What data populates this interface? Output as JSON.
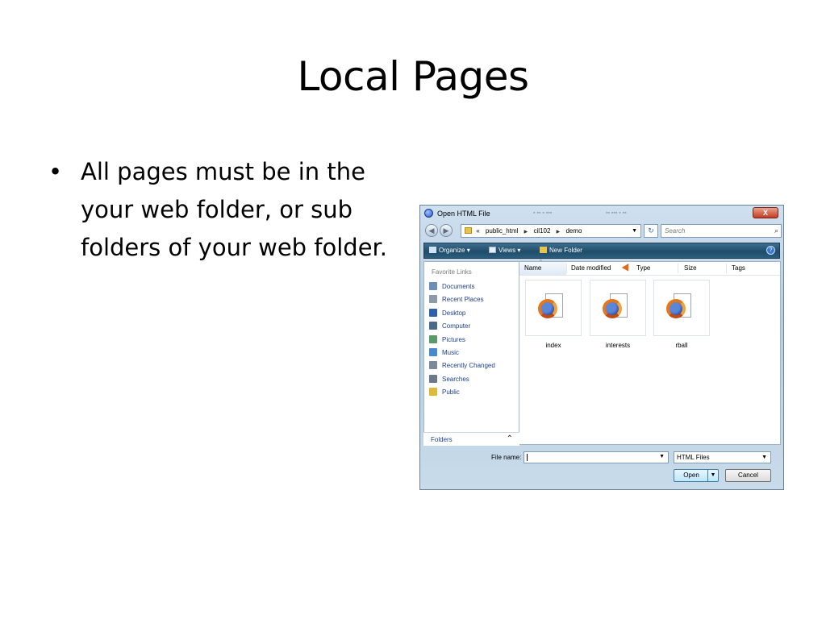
{
  "slide": {
    "title": "Local Pages",
    "bullets": [
      "All pages must be in the your web folder, or sub folders of your web folder."
    ]
  },
  "dialog": {
    "title": "Open HTML File",
    "close_label": "X",
    "address": {
      "overflow": "«",
      "path": [
        "public_html",
        "cil102",
        "demo"
      ],
      "search_placeholder": "Search"
    },
    "toolbar": {
      "organize": "Organize",
      "views": "Views",
      "new_folder": "New Folder"
    },
    "favorites": {
      "header": "Favorite Links",
      "items": [
        {
          "label": "Documents",
          "icon": "documents-icon",
          "color": "#6b8fb8"
        },
        {
          "label": "Recent Places",
          "icon": "recent-places-icon",
          "color": "#8a9aa8"
        },
        {
          "label": "Desktop",
          "icon": "desktop-icon",
          "color": "#2f5fa8"
        },
        {
          "label": "Computer",
          "icon": "computer-icon",
          "color": "#4a6a8a"
        },
        {
          "label": "Pictures",
          "icon": "pictures-icon",
          "color": "#5a9a6a"
        },
        {
          "label": "Music",
          "icon": "music-icon",
          "color": "#4a8ac8"
        },
        {
          "label": "Recently Changed",
          "icon": "recently-changed-icon",
          "color": "#7a8a9a"
        },
        {
          "label": "Searches",
          "icon": "searches-icon",
          "color": "#6a7a8a"
        },
        {
          "label": "Public",
          "icon": "public-folder-icon",
          "color": "#e0b83a"
        }
      ],
      "folders_label": "Folders"
    },
    "columns": [
      "Name",
      "Date modified",
      "Type",
      "Size",
      "Tags"
    ],
    "files": [
      "index",
      "interests",
      "rball"
    ],
    "file_name_label": "File name:",
    "file_name_value": "",
    "file_type": "HTML Files",
    "open_label": "Open",
    "cancel_label": "Cancel"
  }
}
